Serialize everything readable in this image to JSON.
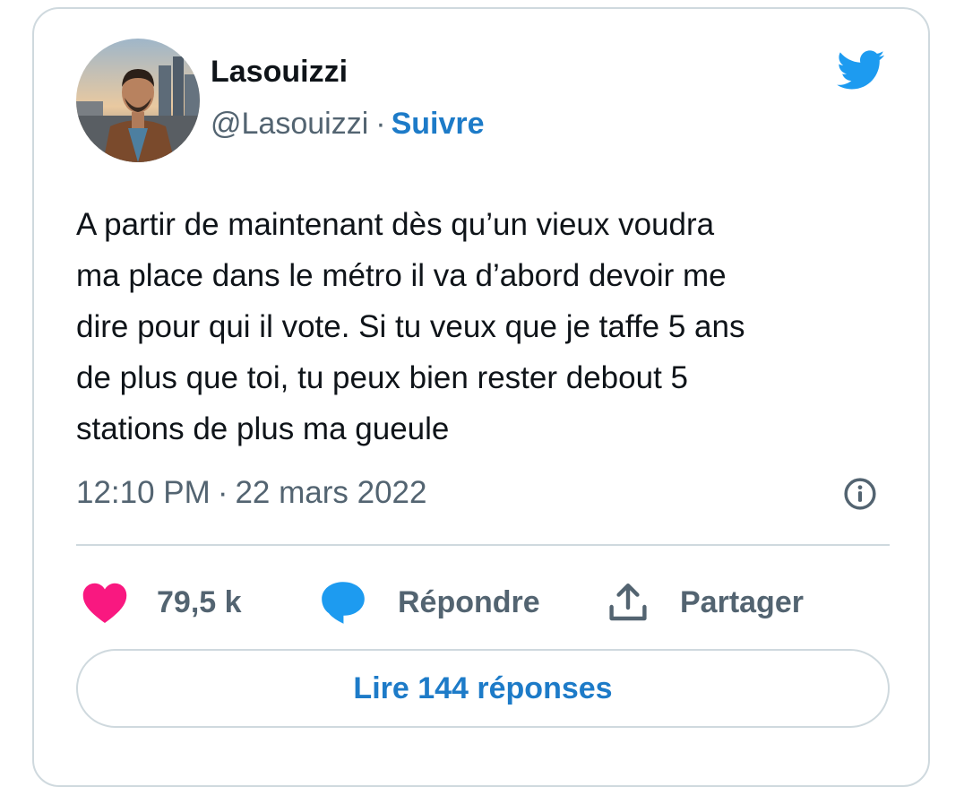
{
  "author": {
    "display_name": "Lasouizzi",
    "handle": "@Lasouizzi",
    "separator": "·",
    "follow_label": "Suivre"
  },
  "tweet": {
    "text": "A partir de maintenant dès qu’un vieux voudra\nma place dans le métro il va d’abord devoir me\ndire pour qui il vote. Si tu veux que je taffe 5 ans\nde plus que toi, tu peux bien rester debout 5\nstations de plus ma gueule",
    "time": "12:10 PM",
    "separator": "·",
    "date": "22 mars 2022"
  },
  "actions": {
    "like_count": "79,5 k",
    "reply_label": "Répondre",
    "share_label": "Partager"
  },
  "read_replies_label": "Lire 144 réponses",
  "icons": {
    "brand": "twitter-bird-icon",
    "info": "info-icon",
    "like": "heart-icon",
    "reply": "speech-bubble-icon",
    "share": "share-upload-icon"
  },
  "colors": {
    "brand_blue": "#1d9bf0",
    "link_blue": "#1d7bc8",
    "like_pink": "#f91880",
    "text_primary": "#0f1419",
    "text_secondary": "#536471",
    "border": "#cfd9de"
  }
}
